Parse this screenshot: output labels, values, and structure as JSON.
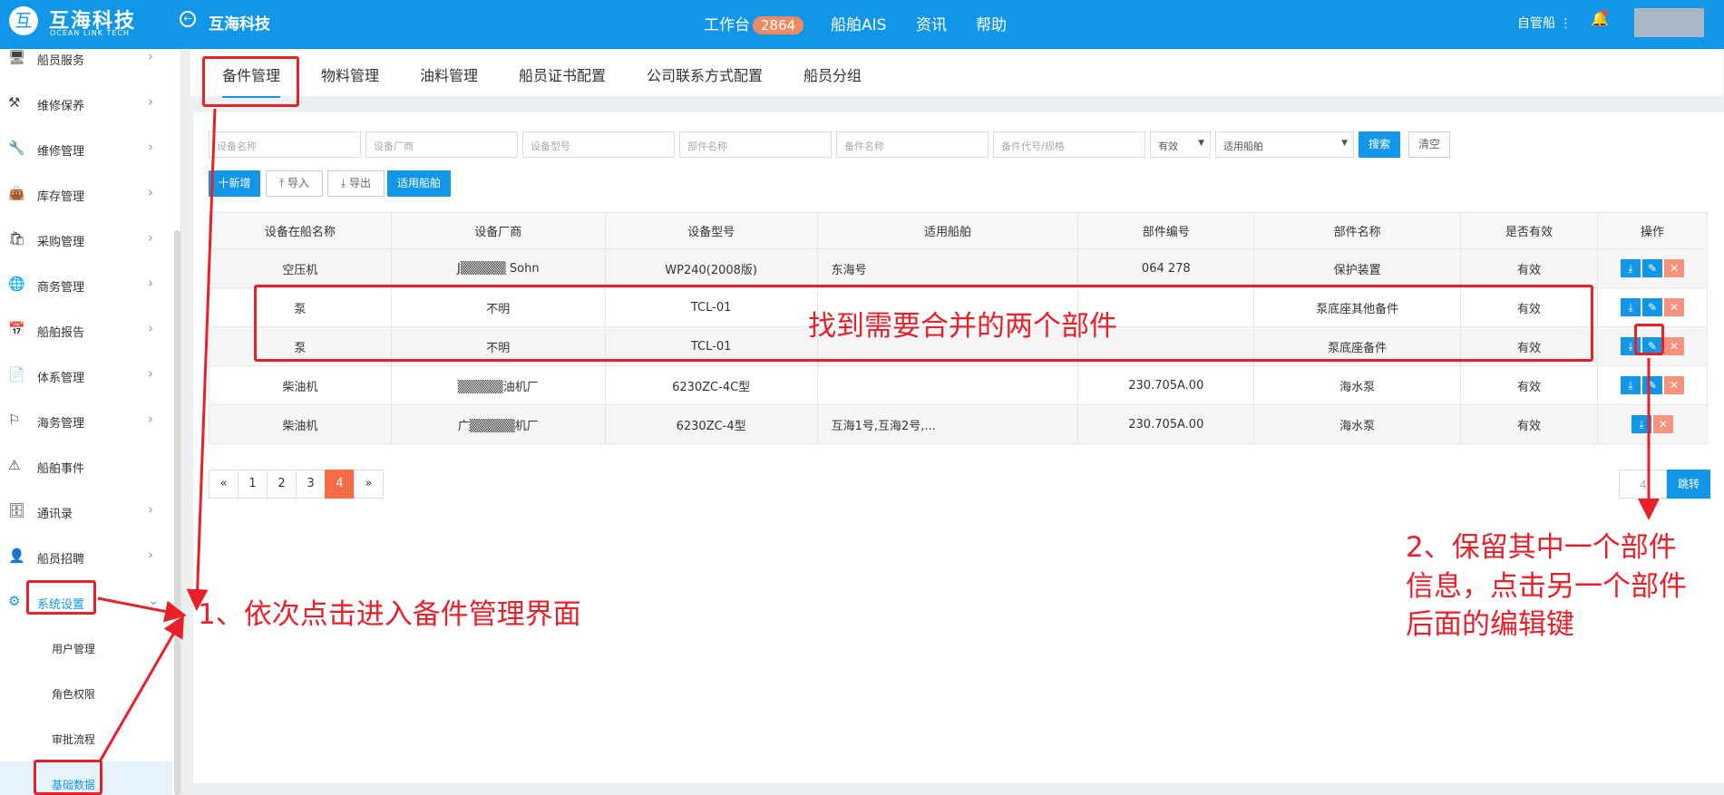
{
  "header": {
    "logo_glyph": "互",
    "brand": "互海科技",
    "brand_sub": "OCEAN LINK TECH",
    "back_glyph": "←",
    "company": "互海科技",
    "nav": [
      "工作台",
      "船舶AIS",
      "资讯",
      "帮助"
    ],
    "workbench_count": "2864",
    "ship_menu": "自管船 ⋮",
    "bell_glyph": "🔔"
  },
  "sidebar": {
    "items": [
      {
        "label": "船员服务",
        "icon": "monitor-icon",
        "glyph": "🖥"
      },
      {
        "label": "维修保养",
        "icon": "hammer-icon",
        "glyph": "⚒"
      },
      {
        "label": "维修管理",
        "icon": "wrench-icon",
        "glyph": "🔧"
      },
      {
        "label": "库存管理",
        "icon": "bag-icon",
        "glyph": "👜"
      },
      {
        "label": "采购管理",
        "icon": "shopping-bag-icon",
        "glyph": "🛍"
      },
      {
        "label": "商务管理",
        "icon": "globe-icon",
        "glyph": "🌐"
      },
      {
        "label": "船舶报告",
        "icon": "calendar-icon",
        "glyph": "📅"
      },
      {
        "label": "体系管理",
        "icon": "document-icon",
        "glyph": "📄"
      },
      {
        "label": "海务管理",
        "icon": "signpost-icon",
        "glyph": "⚐"
      },
      {
        "label": "船舶事件",
        "icon": "warning-icon",
        "glyph": "⚠"
      },
      {
        "label": "通讯录",
        "icon": "address-book-icon",
        "glyph": "🗄"
      },
      {
        "label": "船员招聘",
        "icon": "user-icon",
        "glyph": "👤"
      },
      {
        "label": "系统设置",
        "icon": "gear-icon",
        "glyph": "⚙"
      }
    ],
    "sub_items": [
      "用户管理",
      "角色权限",
      "审批流程",
      "基础数据"
    ],
    "arrow_right": "›",
    "arrow_down": "⌄"
  },
  "tabs": [
    "备件管理",
    "物料管理",
    "油料管理",
    "船员证书配置",
    "公司联系方式配置",
    "船员分组"
  ],
  "filters": {
    "placeholders": [
      "设备名称",
      "设备厂商",
      "设备型号",
      "部件名称",
      "备件名称",
      "备件代号/规格"
    ],
    "valid_select": "有效",
    "ship_select": "适用船舶",
    "select_caret": "▼",
    "search": "搜索",
    "clear": "清空"
  },
  "actions": {
    "add": "十新增",
    "import": "⤒ 导入",
    "export": "⤓ 导出",
    "apply_ships": "适用船舶"
  },
  "table": {
    "columns": [
      "设备在船名称",
      "设备厂商",
      "设备型号",
      "适用船舶",
      "部件编号",
      "部件名称",
      "是否有效",
      "操作"
    ],
    "rows": [
      [
        "空压机",
        "J▒▒▒▒▒ Sohn",
        "WP240(2008版)",
        "东海号",
        "064 278",
        "保护装置",
        "有效"
      ],
      [
        "泵",
        "不明",
        "TCL-01",
        "",
        "",
        "泵底座其他备件",
        "有效"
      ],
      [
        "泵",
        "不明",
        "TCL-01",
        "",
        "",
        "泵底座备件",
        "有效"
      ],
      [
        "柴油机",
        "▒▒▒▒▒油机厂",
        "6230ZC-4C型",
        "",
        "230.705A.00",
        "海水泵",
        "有效"
      ],
      [
        "柴油机",
        "广▒▒▒▒▒机厂",
        "6230ZC-4型",
        "互海1号,互海2号,...",
        "230.705A.00",
        "海水泵",
        "有效"
      ]
    ],
    "op_download": "⤓",
    "op_edit": "✎",
    "op_delete": "✕"
  },
  "pagination": {
    "prev": "«",
    "pages": [
      "1",
      "2",
      "3",
      "4"
    ],
    "next": "»",
    "jump_value": "4",
    "jump_label": "跳转"
  },
  "annotations": {
    "step1": "1、依次点击进入备件管理界面",
    "merge_note": "找到需要合并的两个部件",
    "step2_lines": [
      "2、保留其中一个部件",
      "信息，点击另一个部件",
      "后面的编辑键"
    ],
    "color": "#e8202a"
  }
}
